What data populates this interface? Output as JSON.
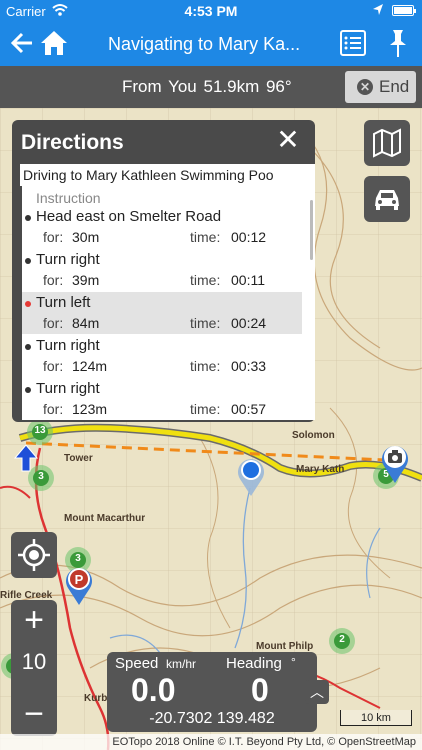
{
  "status_bar": {
    "carrier": "Carrier",
    "time": "4:53 PM"
  },
  "nav": {
    "title": "Navigating to Mary Ka..."
  },
  "info_bar": {
    "route_text": "From You  51.9km  96°",
    "end_label": "End"
  },
  "directions": {
    "title": "Directions",
    "subtitle": "Driving to Mary Kathleen Swimming Poo",
    "column_header": "Instruction",
    "for_label": "for:",
    "time_label": "time:",
    "steps": [
      {
        "instruction": "Head east on Smelter Road",
        "distance": "30m",
        "time": "00:12",
        "selected": false
      },
      {
        "instruction": "Turn right",
        "distance": "39m",
        "time": "00:11",
        "selected": false
      },
      {
        "instruction": "Turn left",
        "distance": "84m",
        "time": "00:24",
        "selected": true
      },
      {
        "instruction": "Turn right",
        "distance": "124m",
        "time": "00:33",
        "selected": false
      },
      {
        "instruction": "Turn right",
        "distance": "123m",
        "time": "00:57",
        "selected": false
      }
    ]
  },
  "map": {
    "labels": [
      "Tower",
      "Mount Macarthur",
      "Mount Philp",
      "Kurb",
      "Rifle Creek",
      "Mary Kath",
      "Solomon"
    ],
    "clusters": [
      "13",
      "3",
      "3",
      "3",
      "2",
      "5"
    ],
    "zoom_level": "10",
    "scale": "10 km",
    "attribution": "EOTopo 2018 Online © I.T. Beyond Pty Ltd, © OpenStreetMap"
  },
  "speed_panel": {
    "speed_label": "Speed",
    "speed_unit": "km/hr",
    "heading_label": "Heading",
    "heading_unit": "°",
    "speed_value": "0.0",
    "heading_value": "0",
    "coordinates": "-20.7302 139.482"
  },
  "colors": {
    "accent": "#1e88e5",
    "panel": "#555555",
    "route": "#f0e010"
  }
}
